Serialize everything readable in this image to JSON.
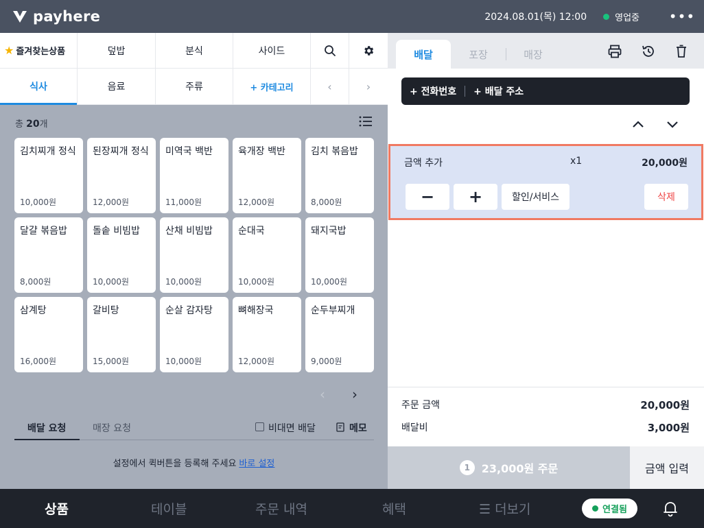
{
  "header": {
    "logo_text": "payhere",
    "datetime": "2024.08.01(목) 12:00",
    "status": "영업중",
    "more": "•••"
  },
  "categories": {
    "row1": [
      "즐겨찾는상품",
      "덮밥",
      "분식",
      "사이드"
    ],
    "row2": [
      "식사",
      "음료",
      "주류",
      "+ 카테고리"
    ],
    "active": "식사"
  },
  "products": {
    "total_prefix": "총",
    "total_count": "20",
    "total_suffix": "개",
    "items": [
      {
        "name": "김치찌개 정식",
        "price": "10,000원"
      },
      {
        "name": "된장찌개 정식",
        "price": "12,000원"
      },
      {
        "name": "미역국 백반",
        "price": "11,000원"
      },
      {
        "name": "육개장 백반",
        "price": "12,000원"
      },
      {
        "name": "김치 볶음밥",
        "price": "8,000원"
      },
      {
        "name": "달걀 볶음밥",
        "price": "8,000원"
      },
      {
        "name": "돌솥 비빔밥",
        "price": "10,000원"
      },
      {
        "name": "산채 비빔밥",
        "price": "10,000원"
      },
      {
        "name": "순대국",
        "price": "10,000원"
      },
      {
        "name": "돼지국밥",
        "price": "10,000원"
      },
      {
        "name": "삼계탕",
        "price": "16,000원"
      },
      {
        "name": "갈비탕",
        "price": "15,000원"
      },
      {
        "name": "순살 감자탕",
        "price": "10,000원"
      },
      {
        "name": "뼈해장국",
        "price": "12,000원"
      },
      {
        "name": "순두부찌개",
        "price": "9,000원"
      }
    ]
  },
  "requests": {
    "tabs": [
      "배달 요청",
      "매장 요청"
    ],
    "contactless": "비대면 배달",
    "memo": "메모",
    "quick_note": "설정에서 퀵버튼을 등록해 주세요",
    "quick_link": "바로 설정"
  },
  "order": {
    "tabs": [
      "배달",
      "포장",
      "매장"
    ],
    "phone": "+ 전화번호",
    "address": "+ 배달 주소",
    "item": {
      "name": "금액 추가",
      "qty": "x1",
      "price": "20,000원",
      "minus": "−",
      "plus": "+",
      "discount": "할인/서비스",
      "delete": "삭제"
    },
    "summary": {
      "order_amount_label": "주문 금액",
      "order_amount": "20,000원",
      "delivery_fee_label": "배달비",
      "delivery_fee": "3,000원"
    },
    "order_count": "1",
    "order_button": "23,000원 주문",
    "amount_input": "금액 입력"
  },
  "bottom_nav": {
    "items": [
      "상품",
      "테이블",
      "주문 내역",
      "혜택",
      "☰ 더보기"
    ],
    "connected": "연결됨"
  },
  "colors": {
    "accent": "#1d8ae0",
    "status_green": "#19c37d",
    "highlight_border": "#f07a62",
    "delete_red": "#ef4444"
  }
}
